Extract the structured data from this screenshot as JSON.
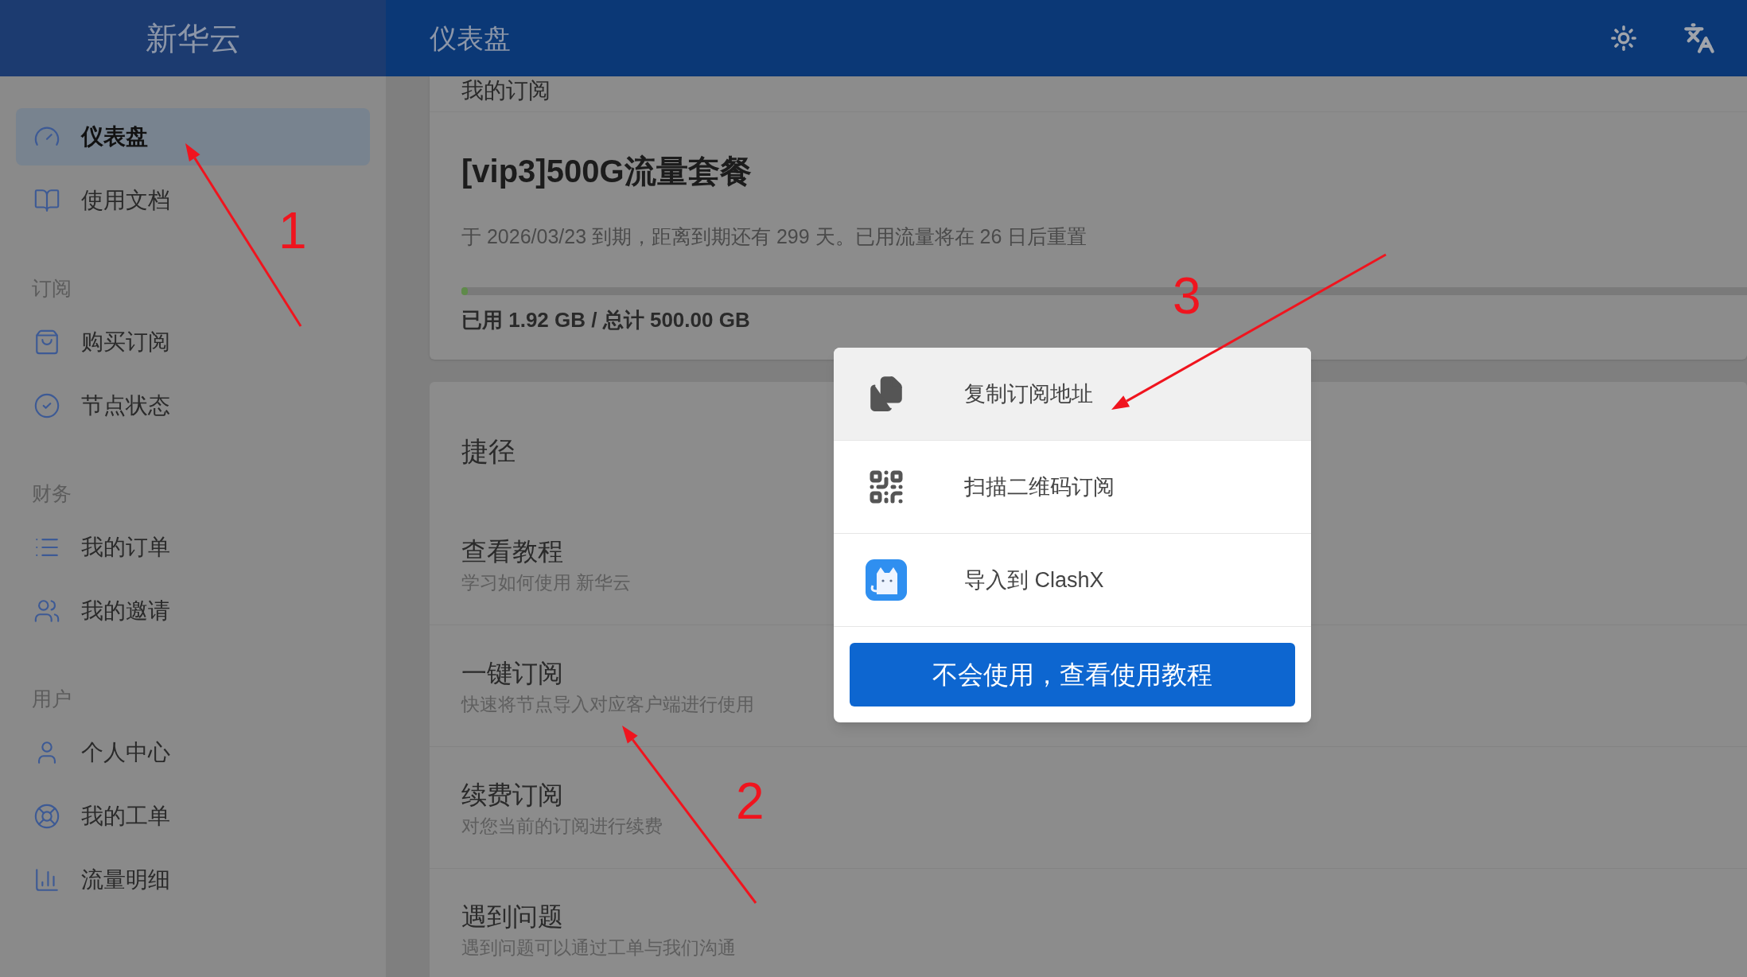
{
  "brand": "新华云",
  "header": {
    "title": "仪表盘"
  },
  "sidebar": {
    "groups": [
      {
        "items": [
          {
            "label": "仪表盘",
            "selected": true
          },
          {
            "label": "使用文档",
            "selected": false
          }
        ]
      },
      {
        "heading": "订阅",
        "items": [
          {
            "label": "购买订阅",
            "selected": false
          },
          {
            "label": "节点状态",
            "selected": false
          }
        ]
      },
      {
        "heading": "财务",
        "items": [
          {
            "label": "我的订单",
            "selected": false
          },
          {
            "label": "我的邀请",
            "selected": false
          }
        ]
      },
      {
        "heading": "用户",
        "items": [
          {
            "label": "个人中心",
            "selected": false
          },
          {
            "label": "我的工单",
            "selected": false
          },
          {
            "label": "流量明细",
            "selected": false
          }
        ]
      }
    ]
  },
  "subscription": {
    "section_title": "我的订阅",
    "plan": "[vip3]500G流量套餐",
    "expiry": "于 2026/03/23 到期，距离到期还有 299 天。已用流量将在 26 日后重置",
    "usage": {
      "level": 0.004,
      "text": "已用 1.92 GB / 总计 500.00 GB"
    }
  },
  "shortcuts": {
    "title": "捷径",
    "items": [
      {
        "title": "查看教程",
        "description": "学习如何使用 新华云"
      },
      {
        "title": "一键订阅",
        "description": "快速将节点导入对应客户端进行使用"
      },
      {
        "title": "续费订阅",
        "description": "对您当前的订阅进行续费"
      },
      {
        "title": "遇到问题",
        "description": "遇到问题可以通过工单与我们沟通"
      }
    ]
  },
  "subscribe_menu": {
    "items": [
      {
        "label": "复制订阅地址",
        "selected": true
      },
      {
        "label": "扫描二维码订阅",
        "selected": false
      },
      {
        "label": "导入到 ClashX",
        "selected": false
      }
    ],
    "button": "不会使用，查看使用教程"
  },
  "annotations": [
    {
      "number": "1"
    },
    {
      "number": "2"
    },
    {
      "number": "3"
    }
  ]
}
